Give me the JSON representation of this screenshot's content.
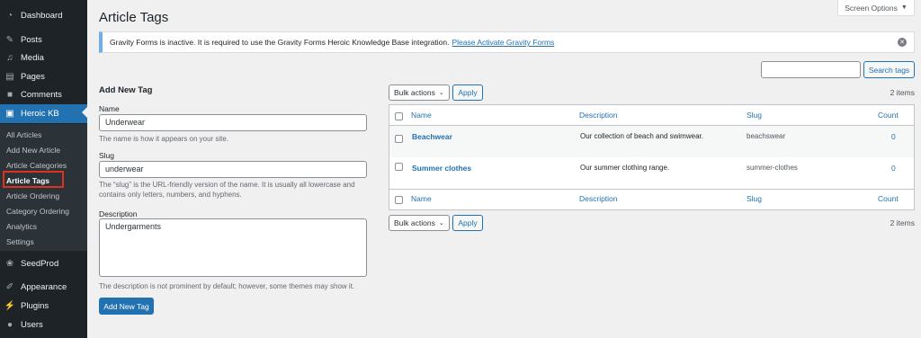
{
  "sidebar": {
    "items": [
      {
        "label": "Dashboard",
        "icon": "dashboard-icon"
      },
      {
        "label": "Posts",
        "icon": "pin-icon"
      },
      {
        "label": "Media",
        "icon": "media-icon"
      },
      {
        "label": "Pages",
        "icon": "pages-icon"
      },
      {
        "label": "Comments",
        "icon": "comment-icon"
      },
      {
        "label": "Heroic KB",
        "icon": "heroic-kb-icon",
        "active": true
      },
      {
        "label": "SeedProd",
        "icon": "seedprod-icon"
      },
      {
        "label": "Appearance",
        "icon": "brush-icon"
      },
      {
        "label": "Plugins",
        "icon": "plug-icon"
      },
      {
        "label": "Users",
        "icon": "user-icon"
      }
    ],
    "submenu": [
      "All Articles",
      "Add New Article",
      "Article Categories",
      "Article Tags",
      "Article Ordering",
      "Category Ordering",
      "Analytics",
      "Settings"
    ],
    "current_submenu": "Article Tags"
  },
  "header": {
    "title": "Article Tags",
    "screen_options": "Screen Options"
  },
  "notice": {
    "text": "Gravity Forms is inactive. It is required to use the Gravity Forms Heroic Knowledge Base integration.",
    "link": "Please Activate Gravity Forms"
  },
  "search": {
    "value": "",
    "button_label": "Search tags"
  },
  "form": {
    "heading": "Add New Tag",
    "name_label": "Name",
    "name_value": "Underwear",
    "name_help": "The name is how it appears on your site.",
    "slug_label": "Slug",
    "slug_value": "underwear",
    "slug_help": "The “slug” is the URL-friendly version of the name. It is usually all lowercase and contains only letters, numbers, and hyphens.",
    "description_label": "Description",
    "description_value": "Undergarments",
    "description_help": "The description is not prominent by default; however, some themes may show it.",
    "submit_label": "Add New Tag"
  },
  "table": {
    "bulk_actions": "Bulk actions",
    "apply": "Apply",
    "items_count": "2 items",
    "columns": [
      "Name",
      "Description",
      "Slug",
      "Count"
    ],
    "rows": [
      {
        "name": "Beachwear",
        "description": "Our collection of beach and swimwear.",
        "slug": "beachswear",
        "count": "0"
      },
      {
        "name": "Summer clothes",
        "description": "Our summer clothing range.",
        "slug": "summer-clothes",
        "count": "0"
      }
    ]
  },
  "colors": {
    "sidebar_bg": "#1d2327",
    "accent": "#2271b1",
    "highlight_box": "#e0311f"
  }
}
